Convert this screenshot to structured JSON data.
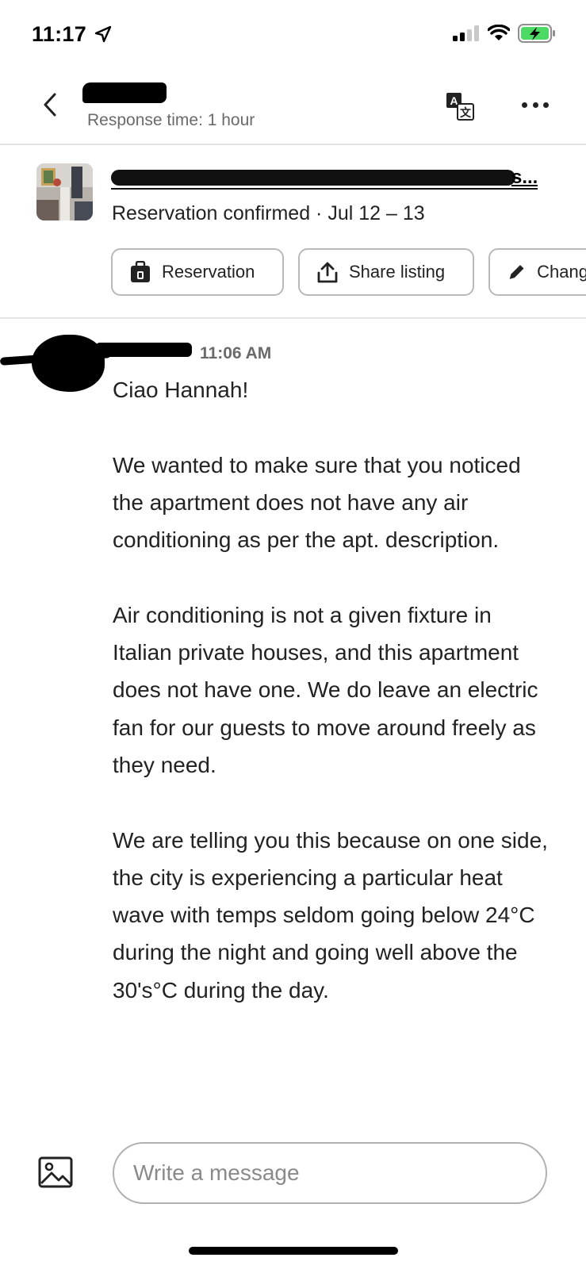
{
  "status_bar": {
    "time": "11:17",
    "location_icon": "location-arrow-icon",
    "signal_icon": "cellular-signal-icon",
    "wifi_icon": "wifi-icon",
    "battery_icon": "battery-charging-icon",
    "battery_color": "#4cd964"
  },
  "header": {
    "back_icon": "chevron-left-icon",
    "response_time": "Response time: 1 hour",
    "translate_icon": "translate-icon",
    "more_icon": "more-dots-icon"
  },
  "listing": {
    "title_visible_suffix": "s...",
    "status": "Reservation confirmed · Jul 12 – 13",
    "actions": [
      {
        "label": "Reservation",
        "icon": "suitcase-icon"
      },
      {
        "label": "Share listing",
        "icon": "share-icon"
      },
      {
        "label": "Chang",
        "icon": "pencil-icon"
      }
    ]
  },
  "message": {
    "time": "11:06 AM",
    "paragraphs": [
      "Ciao Hannah!",
      "We wanted to make sure that you noticed the apartment does not have any air conditioning as per the apt. description.",
      "Air conditioning is not a given fixture in Italian private houses, and this apartment does not have one. We do leave an electric fan for our guests to move around freely as they need.",
      "We are telling you this because on one side, the city is experiencing a particular heat wave with temps seldom going below 24°C during the night and going well above the 30's°C during the day."
    ]
  },
  "compose": {
    "image_icon": "image-icon",
    "placeholder": "Write a message"
  },
  "colors": {
    "text_primary": "#222222",
    "text_secondary": "#6a6a6a",
    "border": "#b9b9b9",
    "divider": "#e3e3e3"
  }
}
